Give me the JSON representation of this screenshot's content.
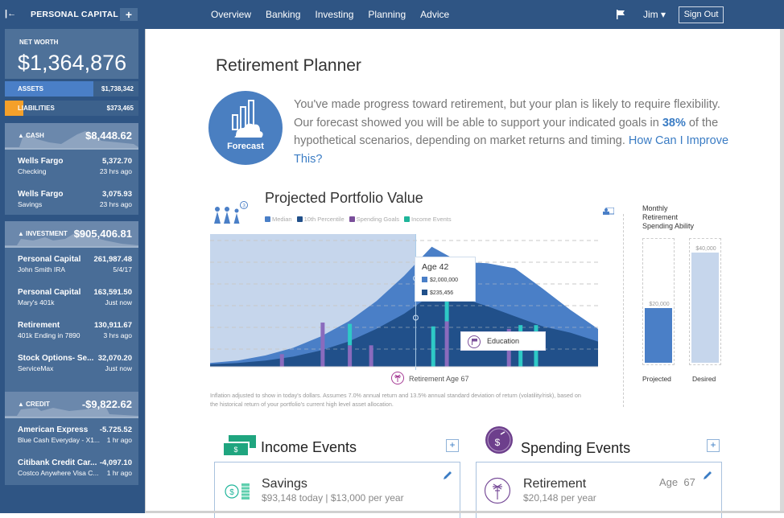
{
  "topbar": {
    "brand": "PERSONAL CAPITAL",
    "add_label": "+",
    "nav": [
      "Overview",
      "Banking",
      "Investing",
      "Planning",
      "Advice"
    ],
    "user": "Jim ▾",
    "signout": "Sign Out"
  },
  "sidebar": {
    "net_worth_label": "NET WORTH",
    "net_worth": "$1,364,876",
    "assets_label": "ASSETS",
    "assets": "$1,738,342",
    "assets_fraction": 0.66,
    "liabilities_label": "LIABILITIES",
    "liabilities": "$373,465",
    "liabilities_fraction": 0.14,
    "cash": {
      "title": "CASH",
      "total": "$8,448.62",
      "accounts": [
        {
          "name": "Wells Fargo",
          "sub": "Checking",
          "value": "5,372.70",
          "time": "23 hrs ago"
        },
        {
          "name": "Wells Fargo",
          "sub": "Savings",
          "value": "3,075.93",
          "time": "23 hrs ago"
        }
      ]
    },
    "investment": {
      "title": "INVESTMENT",
      "total": "$905,406.81",
      "accounts": [
        {
          "name": "Personal Capital",
          "sub": "John Smith IRA",
          "value": "261,987.48",
          "time": "5/4/17"
        },
        {
          "name": "Personal Capital",
          "sub": "Mary's 401k",
          "value": "163,591.50",
          "time": "Just now"
        },
        {
          "name": "Retirement",
          "sub": "401k Ending in 7890",
          "value": "130,911.67",
          "time": "3 hrs ago"
        },
        {
          "name": "Stock Options- Se...",
          "sub": "ServiceMax",
          "value": "32,070.20",
          "time": "Just now"
        }
      ]
    },
    "credit": {
      "title": "CREDIT",
      "total": "-$9,822.62",
      "accounts": [
        {
          "name": "American Express",
          "sub": "Blue Cash Everyday - X1...",
          "value": "-5.725.52",
          "time": "1 hr ago"
        },
        {
          "name": "Citibank Credit Car...",
          "sub": "Costco Anywhere Visa C...",
          "value": "-4,097.10",
          "time": "1 hr ago"
        }
      ]
    }
  },
  "main": {
    "title": "Retirement Planner",
    "forecast_label": "Forecast",
    "summary_pre": "You've made progress toward retirement, but your plan is likely to require flexibility. Our forecast showed you will be able to support your indicated goals in ",
    "summary_pct": "38%",
    "summary_post": " of the hypothetical scenarios, depending on market returns and timing. ",
    "summary_link": "How Can I Improve This?",
    "people_count": "3",
    "footnote": "Inflation adjusted to show in today's dollars. Assumes 7.0% annual return and 13.5% annual standard deviation of return (volatility/risk), based on the historical return of your portfolio's current high level asset allocation.",
    "retirement_marker": "Retirement Age 67",
    "tooltip": {
      "title": "Age 42",
      "median": "$2,000,000",
      "tenth": "$235,456"
    },
    "education_tip": "Education"
  },
  "chart_data": {
    "type": "area",
    "title": "Projected Portfolio Value",
    "legend": [
      {
        "label": "Median",
        "color": "#4a7fc7"
      },
      {
        "label": "10th Percentile",
        "color": "#21508a"
      },
      {
        "label": "Spending Goals",
        "color": "#7a4f9a"
      },
      {
        "label": "Income Events",
        "color": "#1fb59a"
      }
    ],
    "legend_position": "top-left",
    "grid": true,
    "highlight_age": 42,
    "retirement_age": 67,
    "series": [
      {
        "name": "Median",
        "values": [
          0.03,
          0.05,
          0.09,
          0.15,
          0.24,
          0.36,
          0.52,
          0.72,
          0.95,
          0.83,
          0.82,
          0.78,
          0.62,
          0.45,
          0.3
        ]
      },
      {
        "name": "10th Percentile",
        "values": [
          0.02,
          0.03,
          0.05,
          0.08,
          0.13,
          0.2,
          0.3,
          0.42,
          0.57,
          0.55,
          0.48,
          0.4,
          0.32,
          0.27,
          0.2
        ]
      }
    ],
    "event_bars": [
      {
        "pos": 0.18,
        "spend": 0.1,
        "income": 0
      },
      {
        "pos": 0.285,
        "spend": 0.35,
        "income": 0
      },
      {
        "pos": 0.355,
        "spend": 0.17,
        "income": 0.17
      },
      {
        "pos": 0.41,
        "spend": 0.17,
        "income": 0
      },
      {
        "pos": 0.57,
        "spend": 0,
        "income": 0.32
      },
      {
        "pos": 0.605,
        "spend": 0.36,
        "income": 0.2
      },
      {
        "pos": 0.765,
        "spend": 0.3,
        "income": 0
      },
      {
        "pos": 0.795,
        "spend": 0,
        "income": 0.33
      },
      {
        "pos": 0.835,
        "spend": 0,
        "income": 0.33
      }
    ]
  },
  "spending_ability": {
    "title": [
      "Monthly",
      "Retirement",
      "Spending Ability"
    ],
    "max": 45000,
    "bars": [
      {
        "label": "Projected",
        "value": 20000,
        "display": "$20,000",
        "color": "#4a7fc7"
      },
      {
        "label": "Desired",
        "value": 40000,
        "display": "$40,000",
        "color": "#c6d6ec"
      }
    ]
  },
  "income_events": {
    "title": "Income Events",
    "add_label": "+",
    "items": [
      {
        "name": "Savings",
        "sub": "$93,148 today | $13,000 per year"
      }
    ]
  },
  "spending_events": {
    "title": "Spending Events",
    "add_label": "+",
    "items": [
      {
        "name": "Retirement",
        "sub": "$20,148 per year",
        "age": "Age  67"
      }
    ]
  }
}
